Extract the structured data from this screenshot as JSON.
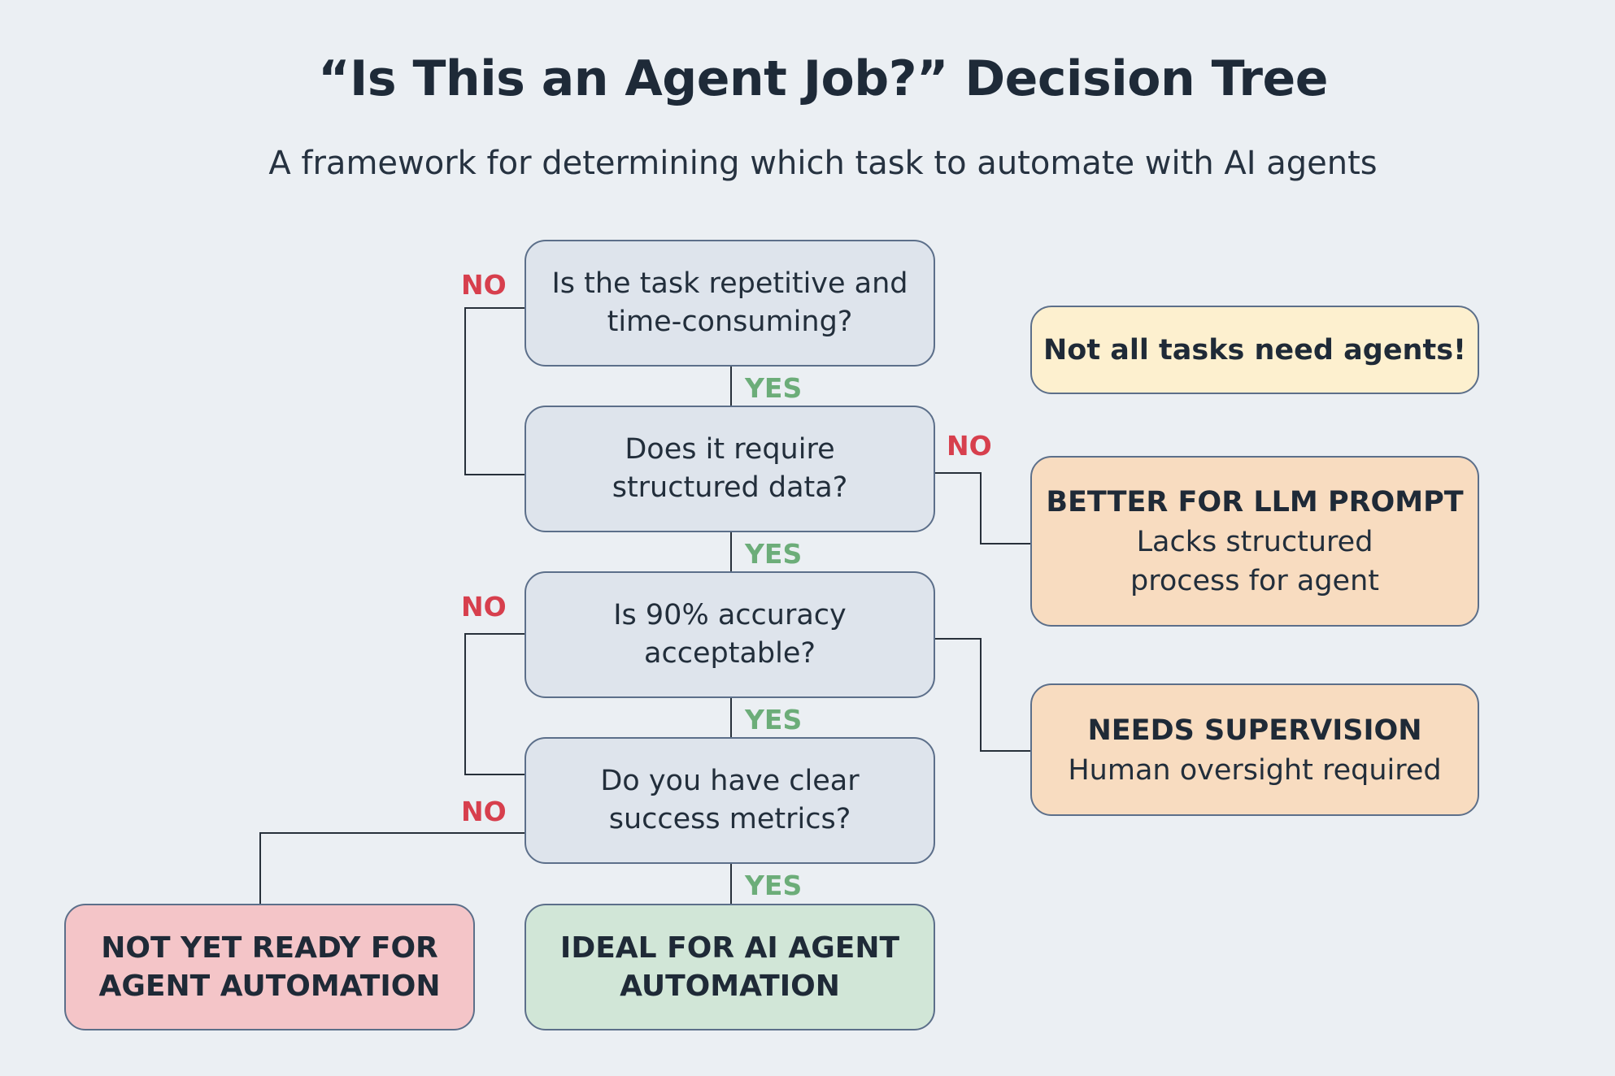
{
  "title": "“Is This an Agent Job?” Decision Tree",
  "subtitle": "A framework for determining which task to automate with AI agents",
  "questions": [
    {
      "line1": "Is the task repetitive and",
      "line2": "time-consuming?"
    },
    {
      "line1": "Does it require",
      "line2": "structured data?"
    },
    {
      "line1": "Is 90% accuracy",
      "line2": "acceptable?"
    },
    {
      "line1": "Do you have clear",
      "line2": "success metrics?"
    }
  ],
  "note": "Not all tasks need agents!",
  "outcomes": {
    "llm_prompt": {
      "title": "BETTER FOR LLM PROMPT",
      "line1": "Lacks structured",
      "line2": "process for agent"
    },
    "supervision": {
      "title": "NEEDS SUPERVISION",
      "line1": "Human oversight required"
    },
    "not_ready": {
      "line1": "NOT YET READY FOR",
      "line2": "AGENT AUTOMATION"
    },
    "ideal": {
      "line1": "IDEAL FOR AI AGENT",
      "line2": "AUTOMATION"
    }
  },
  "labels": {
    "yes": "YES",
    "no": "NO"
  },
  "colors": {
    "background": "#ebeff3",
    "question_fill": "#dee4ec",
    "note_fill": "#fdf0cf",
    "caution_fill": "#f8dcc0",
    "not_ready_fill": "#f4c5c8",
    "ideal_fill": "#d1e6d7",
    "no_label": "#d73f4d",
    "yes_label": "#6cad79"
  }
}
